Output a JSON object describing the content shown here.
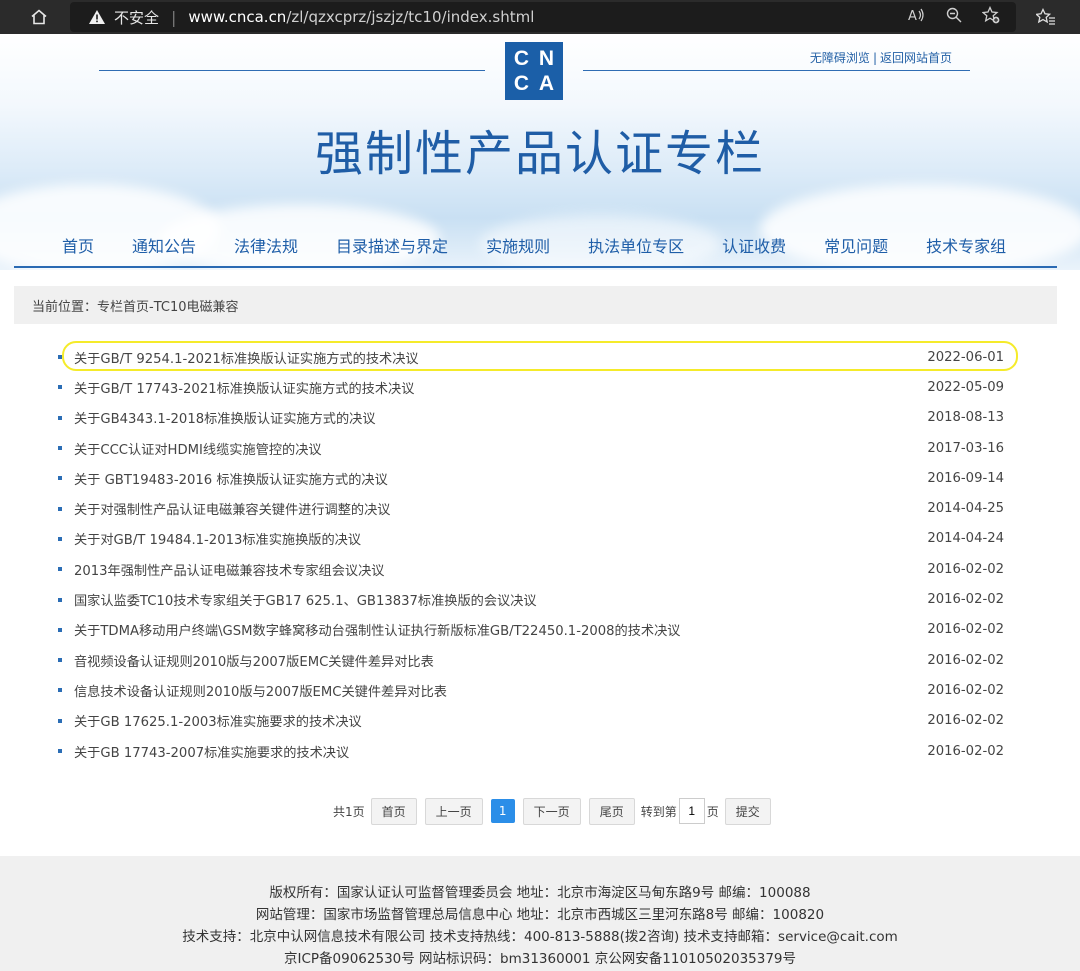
{
  "browser": {
    "insecure_label": "不安全",
    "url_host": "www.cnca.cn",
    "url_path": "/zl/qzxcprz/jszjz/tc10/index.shtml"
  },
  "header": {
    "logo_letters": [
      "C",
      "N",
      "C",
      "A"
    ],
    "accessibility_link": "无障碍浏览",
    "separator": "|",
    "home_link": "返回网站首页",
    "title": "强制性产品认证专栏"
  },
  "nav": {
    "items": [
      "首页",
      "通知公告",
      "法律法规",
      "目录描述与界定",
      "实施规则",
      "执法单位专区",
      "认证收费",
      "常见问题",
      "技术专家组"
    ]
  },
  "breadcrumb": "当前位置：专栏首页-TC10电磁兼容",
  "articles": [
    {
      "title": "关于GB/T 9254.1-2021标准换版认证实施方式的技术决议",
      "date": "2022-06-01"
    },
    {
      "title": "关于GB/T 17743-2021标准换版认证实施方式的技术决议",
      "date": "2022-05-09"
    },
    {
      "title": "关于GB4343.1-2018标准换版认证实施方式的决议",
      "date": "2018-08-13"
    },
    {
      "title": "关于CCC认证对HDMI线缆实施管控的决议",
      "date": "2017-03-16"
    },
    {
      "title": "关于 GBT19483-2016 标准换版认证实施方式的决议",
      "date": "2016-09-14"
    },
    {
      "title": "关于对强制性产品认证电磁兼容关键件进行调整的决议",
      "date": "2014-04-25"
    },
    {
      "title": "关于对GB/T 19484.1-2013标准实施换版的决议",
      "date": "2014-04-24"
    },
    {
      "title": "2013年强制性产品认证电磁兼容技术专家组会议决议",
      "date": "2016-02-02"
    },
    {
      "title": "国家认监委TC10技术专家组关于GB17 625.1、GB13837标准换版的会议决议",
      "date": "2016-02-02"
    },
    {
      "title": "关于TDMA移动用户终端\\GSM数字蜂窝移动台强制性认证执行新版标准GB/T22450.1-2008的技术决议",
      "date": "2016-02-02"
    },
    {
      "title": "音视频设备认证规则2010版与2007版EMC关键件差异对比表",
      "date": "2016-02-02"
    },
    {
      "title": "信息技术设备认证规则2010版与2007版EMC关键件差异对比表",
      "date": "2016-02-02"
    },
    {
      "title": "关于GB 17625.1-2003标准实施要求的技术决议",
      "date": "2016-02-02"
    },
    {
      "title": "关于GB 17743-2007标准实施要求的技术决议",
      "date": "2016-02-02"
    }
  ],
  "pager": {
    "total": "共1页",
    "first": "首页",
    "prev": "上一页",
    "current": "1",
    "next": "下一页",
    "last": "尾页",
    "goto_prefix": "转到第",
    "goto_value": "1",
    "goto_suffix": "页",
    "submit": "提交"
  },
  "footer": {
    "lines": [
      "版权所有：国家认证认可监督管理委员会  地址：北京市海淀区马甸东路9号  邮编：100088",
      "网站管理：国家市场监督管理总局信息中心  地址：北京市西城区三里河东路8号  邮编：100820",
      "技术支持：北京中认网信息技术有限公司  技术支持热线：400-813-5888(拨2咨询)  技术支持邮箱：service@cait.com",
      "京ICP备09062530号  网站标识码：bm31360001  京公网安备11010502035379号"
    ]
  },
  "colors": {
    "brand_blue": "#1f5da6",
    "highlight_yellow": "#f5eb2a",
    "pager_active": "#2b8ee8"
  }
}
